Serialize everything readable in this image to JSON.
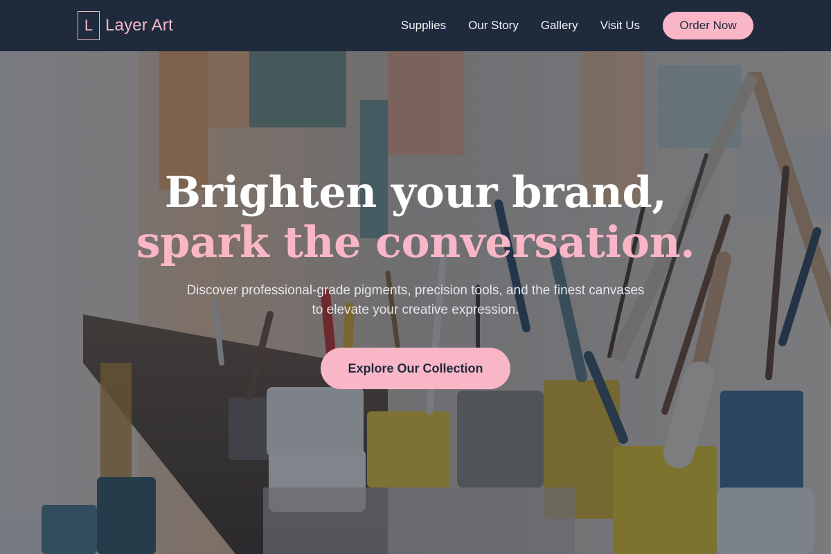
{
  "brand": {
    "logo_letter": "L",
    "name": "Layer Art"
  },
  "nav": {
    "links": [
      "Supplies",
      "Our Story",
      "Gallery",
      "Visit Us"
    ],
    "cta_label": "Order Now"
  },
  "hero": {
    "headline_line1": "Brighten your brand,",
    "headline_line2": "spark the conversation.",
    "subtext": "Discover professional-grade pigments, precision tools, and the finest canvases to elevate your creative expression.",
    "cta_label": "Explore Our Collection"
  },
  "colors": {
    "nav_bg": "#1f2a3d",
    "accent_pink": "#f8b6c6",
    "text_light": "#f1f3f7"
  }
}
